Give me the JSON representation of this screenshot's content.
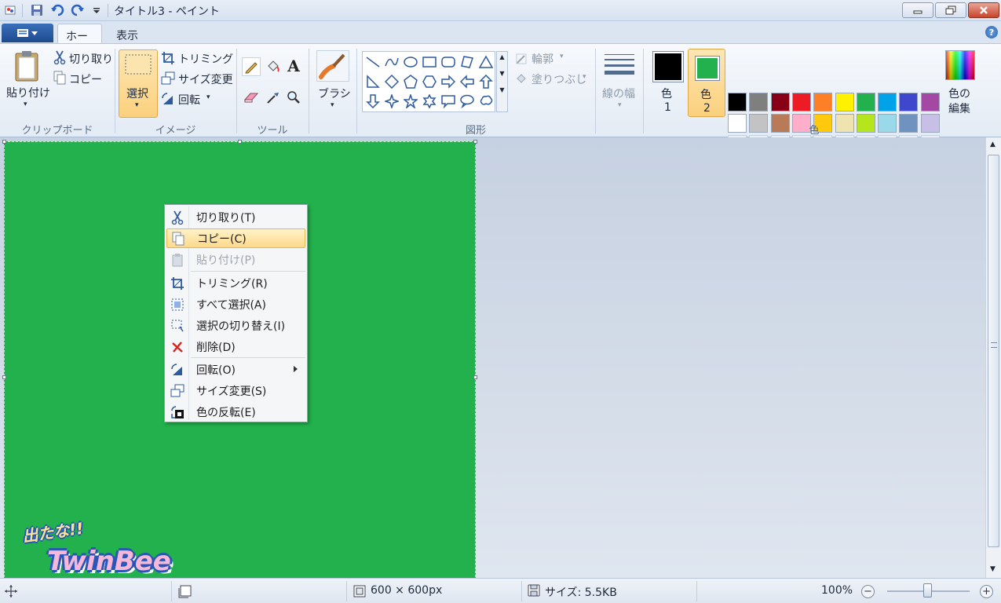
{
  "window": {
    "title": "タイトル3 - ペイント"
  },
  "tabs": [
    {
      "label": "ホーム",
      "active": true
    },
    {
      "label": "表示",
      "active": false
    }
  ],
  "ribbon": {
    "clipboard": {
      "paste": "貼り付け",
      "cut": "切り取り",
      "copy": "コピー",
      "group": "クリップボード"
    },
    "image": {
      "select": "選択",
      "crop": "トリミング",
      "resize": "サイズ変更",
      "rotate": "回転",
      "group": "イメージ"
    },
    "tools": {
      "group": "ツール"
    },
    "brush": {
      "label": "ブラシ"
    },
    "shapes": {
      "outline": "輪郭",
      "fill": "塗りつぶし",
      "group": "図形"
    },
    "size": {
      "label": "線の幅"
    },
    "colors": {
      "color1_label": "色",
      "color1_num": "1",
      "color2_label": "色",
      "color2_num": "2",
      "edit_label1": "色の",
      "edit_label2": "編集",
      "group": "色",
      "color1": "#000000",
      "color2": "#22b14c",
      "palette_row1": [
        "#000000",
        "#7f7f7f",
        "#880015",
        "#ed1c24",
        "#ff7f27",
        "#fff200",
        "#22b14c",
        "#00a2e8",
        "#3f48cc",
        "#a349a4"
      ],
      "palette_row2": [
        "#ffffff",
        "#c3c3c3",
        "#b97a57",
        "#ffaec9",
        "#ffc90e",
        "#efe4b0",
        "#b5e61d",
        "#99d9ea",
        "#7092be",
        "#c8bfe7"
      ]
    }
  },
  "canvas": {
    "background": "#22b14c"
  },
  "logo": {
    "line1": "出たな!!",
    "line2": "TwinBee"
  },
  "context_menu": {
    "items": [
      {
        "label": "切り取り(T)",
        "icon": "scissors-icon"
      },
      {
        "label": "コピー(C)",
        "icon": "copy-icon",
        "highlighted": true
      },
      {
        "label": "貼り付け(P)",
        "icon": "paste-icon",
        "disabled": true
      },
      {
        "label": "トリミング(R)",
        "icon": "crop-icon"
      },
      {
        "label": "すべて選択(A)",
        "icon": "select-all-icon"
      },
      {
        "label": "選択の切り替え(I)",
        "icon": "invert-selection-icon"
      },
      {
        "label": "削除(D)",
        "icon": "delete-icon"
      },
      {
        "label": "回転(O)",
        "icon": "rotate-icon",
        "submenu": true
      },
      {
        "label": "サイズ変更(S)",
        "icon": "resize-icon"
      },
      {
        "label": "色の反転(E)",
        "icon": "invert-color-icon"
      }
    ]
  },
  "status": {
    "dimensions": "600 × 600px",
    "size": "サイズ: 5.5KB",
    "zoom": "100%",
    "zoom_level": 1.0
  }
}
